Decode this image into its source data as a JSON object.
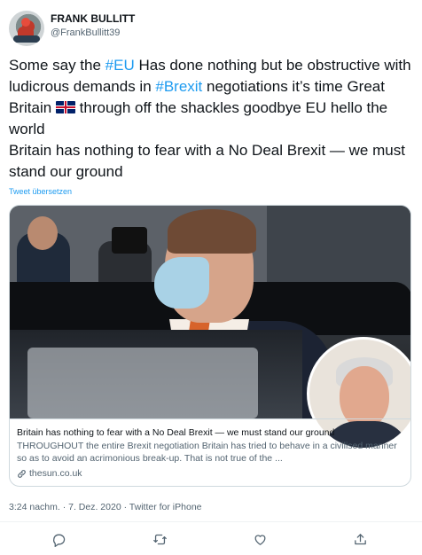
{
  "author": {
    "display_name": "FRANK BULLITT",
    "handle": "@FrankBullitt39"
  },
  "tweet": {
    "line1_pre": "Some say the ",
    "hashtag_eu": "#EU",
    "line1_post": " Has done nothing but be obstructive with ludicrous demands in ",
    "hashtag_brexit": "#Brexit",
    "line2_post": " negotiations it’s time Great Britain ",
    "flag_emoji": "uk-flag-icon",
    "line3_post": " through off the shackles goodbye EU hello the world\nBritain has nothing to fear with a No Deal Brexit — we must stand our ground",
    "translate_label": "Tweet übersetzen"
  },
  "card": {
    "title": "Britain has nothing to fear with a No Deal Brexit — we must stand our ground",
    "description": "THROUGHOUT the entire Brexit negotiation Britain has tried to behave in a civilised manner so as to avoid an acrimonious break-up. That is not true of the ...",
    "domain": "thesun.co.uk"
  },
  "meta": {
    "timestamp": "3:24 nachm. · 7. Dez. 2020 · Twitter for iPhone"
  },
  "colors": {
    "accent": "#1d9bf0",
    "text": "#0f1419",
    "secondary": "#536471",
    "border": "#cfd9de"
  },
  "actions": [
    "reply-icon",
    "retweet-icon",
    "like-icon",
    "share-icon"
  ]
}
